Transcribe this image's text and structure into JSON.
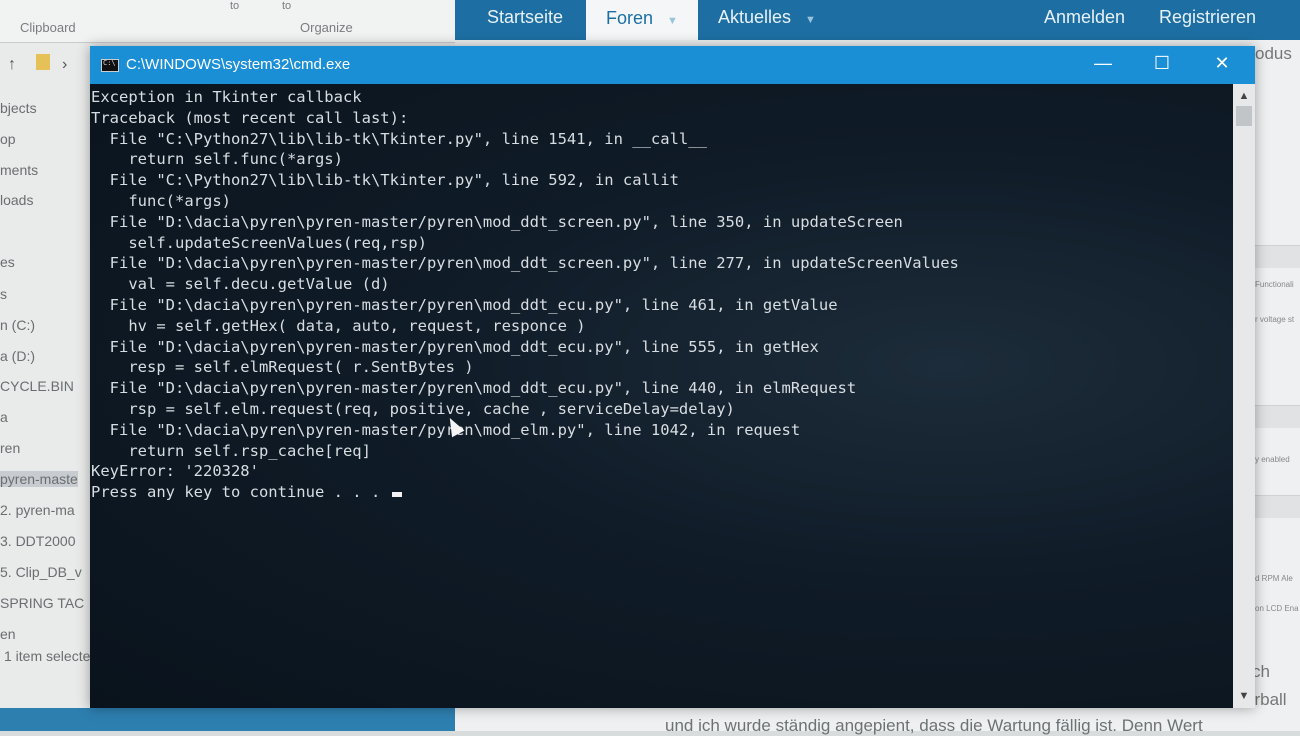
{
  "explorer": {
    "ribbon_groups": [
      "Clipboard",
      "Organize"
    ],
    "ribbon_small": [
      "to",
      "to"
    ],
    "nav_items": [
      "bjects",
      "op",
      "ments",
      "loads",
      "es",
      "s",
      "n (C:)",
      "a (D:)",
      "CYCLE.BIN",
      "a",
      "ren",
      "pyren-maste",
      "2. pyren-ma",
      "3. DDT2000",
      "5. Clip_DB_v",
      "SPRING TAC",
      "en"
    ],
    "selected_index": 11,
    "status": "1 item selecte"
  },
  "forum": {
    "nav": [
      {
        "label": "Startseite"
      },
      {
        "label": "Foren"
      },
      {
        "label": "Aktuelles"
      }
    ],
    "auth": [
      "Anmelden",
      "Registrieren"
    ],
    "side_snippets": [
      "Functionali",
      "r voltage st",
      "y enabled",
      "d RPM Ale",
      "on LCD Ena"
    ],
    "side_text_top": "odus",
    "side_text_bottom_1": "ch",
    "side_text_bottom_2": "erball",
    "bottom_text": "und ich wurde ständig angepient, dass die Wartung fällig ist. Denn Wert"
  },
  "cmd": {
    "title": "C:\\WINDOWS\\system32\\cmd.exe",
    "buttons": {
      "minimize": "—",
      "maximize": "☐",
      "close": "✕"
    },
    "lines": [
      "Exception in Tkinter callback",
      "Traceback (most recent call last):",
      "  File \"C:\\Python27\\lib\\lib-tk\\Tkinter.py\", line 1541, in __call__",
      "    return self.func(*args)",
      "  File \"C:\\Python27\\lib\\lib-tk\\Tkinter.py\", line 592, in callit",
      "    func(*args)",
      "  File \"D:\\dacia\\pyren\\pyren-master/pyren\\mod_ddt_screen.py\", line 350, in updateScreen",
      "    self.updateScreenValues(req,rsp)",
      "  File \"D:\\dacia\\pyren\\pyren-master/pyren\\mod_ddt_screen.py\", line 277, in updateScreenValues",
      "    val = self.decu.getValue (d)",
      "  File \"D:\\dacia\\pyren\\pyren-master/pyren\\mod_ddt_ecu.py\", line 461, in getValue",
      "    hv = self.getHex( data, auto, request, responce )",
      "  File \"D:\\dacia\\pyren\\pyren-master/pyren\\mod_ddt_ecu.py\", line 555, in getHex",
      "    resp = self.elmRequest( r.SentBytes )",
      "  File \"D:\\dacia\\pyren\\pyren-master/pyren\\mod_ddt_ecu.py\", line 440, in elmRequest",
      "    rsp = self.elm.request(req, positive, cache , serviceDelay=delay)",
      "  File \"D:\\dacia\\pyren\\pyren-master/pyren\\mod_elm.py\", line 1042, in request",
      "    return self.rsp_cache[req]",
      "KeyError: '220328'",
      "Press any key to continue . . . "
    ]
  }
}
